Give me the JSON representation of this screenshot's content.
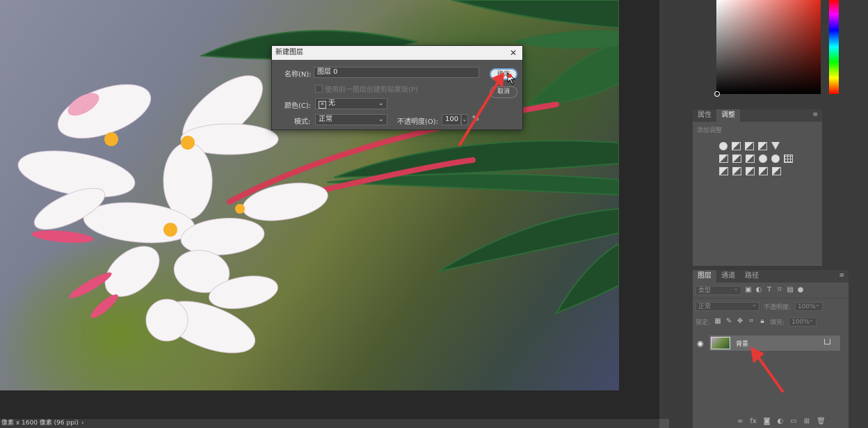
{
  "status": {
    "text": "像素 x 1600 像素 (96 ppi)",
    "chevron": "›"
  },
  "dialog": {
    "title": "新建图层",
    "close": "✕",
    "name_label": "名称(N):",
    "name_value": "图层 0",
    "clip_label": "使用前一图层创建剪贴蒙版(P)",
    "color_label": "颜色(C):",
    "color_value": "无",
    "mode_label": "模式:",
    "mode_value": "正常",
    "opacity_label": "不透明度(O):",
    "opacity_value": "100",
    "opacity_unit": "%",
    "ok_label": "确定",
    "cancel_label": "取消"
  },
  "adjustments": {
    "tabs": [
      "属性",
      "调整"
    ],
    "active_tab": 1,
    "hint": "添加调整"
  },
  "layers": {
    "tabs": [
      "图层",
      "通道",
      "路径"
    ],
    "active_tab": 0,
    "filter_placeholder": "类型",
    "blend_mode": "正常",
    "opacity_label": "不透明度:",
    "opacity_value": "100%",
    "lock_label": "锁定:",
    "fill_label": "填充:",
    "fill_value": "100%",
    "layer_name": "背景"
  },
  "colors": {
    "accent_arrow": "#e53935",
    "ok_focus": "#6aa0d8"
  }
}
